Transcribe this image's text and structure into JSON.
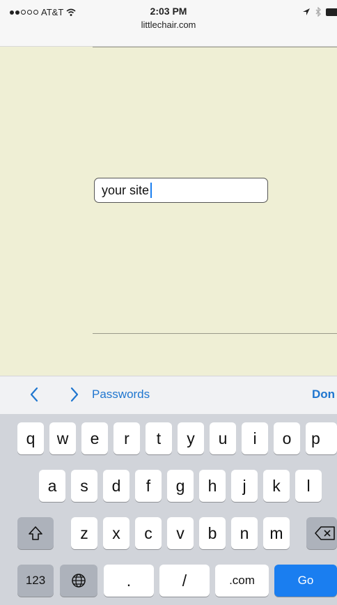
{
  "status_bar": {
    "carrier": "AT&T",
    "time": "2:03 PM",
    "url": "littlechair.com"
  },
  "form": {
    "site_input_value": "your site"
  },
  "accessory": {
    "passwords_label": "Passwords",
    "done_label": "Don"
  },
  "keyboard": {
    "row1": [
      "q",
      "w",
      "e",
      "r",
      "t",
      "y",
      "u",
      "i",
      "o",
      "p"
    ],
    "row2": [
      "a",
      "s",
      "d",
      "f",
      "g",
      "h",
      "j",
      "k",
      "l"
    ],
    "row3": [
      "z",
      "x",
      "c",
      "v",
      "b",
      "n",
      "m"
    ],
    "numbers_key": "123",
    "period_key": ".",
    "slash_key": "/",
    "dotcom_key": ".com",
    "go_key": "Go"
  },
  "colors": {
    "page_background": "#efefd5",
    "accent": "#1a7ef0",
    "link": "#1f76cf"
  }
}
